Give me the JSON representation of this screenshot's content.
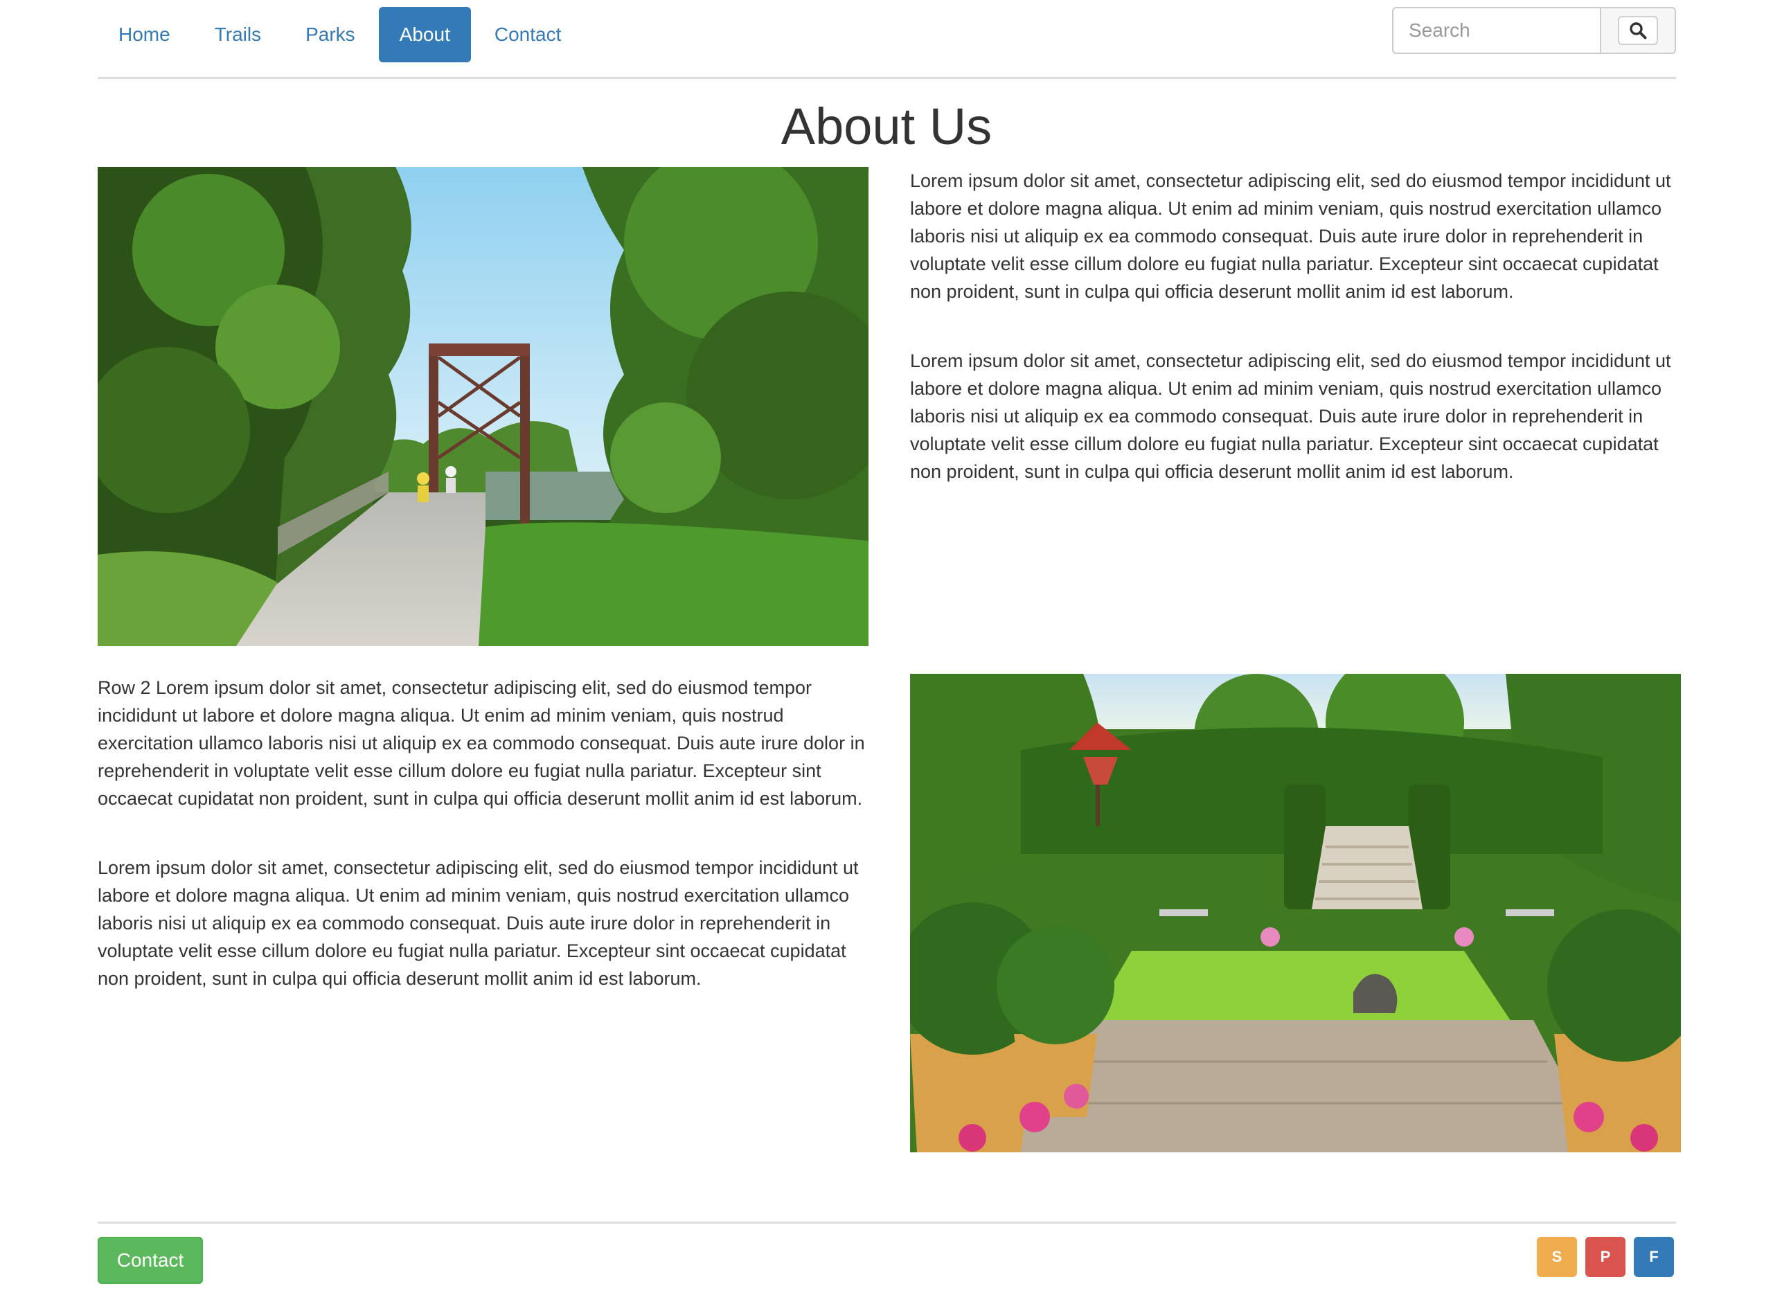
{
  "nav": {
    "tabs": [
      {
        "label": "Home"
      },
      {
        "label": "Trails"
      },
      {
        "label": "Parks"
      },
      {
        "label": "About"
      },
      {
        "label": "Contact"
      }
    ],
    "active_tab": "About",
    "search": {
      "placeholder": "Search",
      "value": "",
      "button_icon": "search-icon"
    }
  },
  "page": {
    "title": "About Us"
  },
  "row1": {
    "image": {
      "subject": "trail-bridge-photo"
    },
    "paragraphs": [
      "Lorem ipsum dolor sit amet, consectetur adipiscing elit, sed do eiusmod tempor incididunt ut labore et dolore magna aliqua. Ut enim ad minim veniam, quis nostrud exercitation ullamco laboris nisi ut aliquip ex ea commodo consequat. Duis aute irure dolor in reprehenderit in voluptate velit esse cillum dolore eu fugiat nulla pariatur. Excepteur sint occaecat cupidatat non proident, sunt in culpa qui officia deserunt mollit anim id est laborum.",
      "Lorem ipsum dolor sit amet, consectetur adipiscing elit, sed do eiusmod tempor incididunt ut labore et dolore magna aliqua. Ut enim ad minim veniam, quis nostrud exercitation ullamco laboris nisi ut aliquip ex ea commodo consequat. Duis aute irure dolor in reprehenderit in voluptate velit esse cillum dolore eu fugiat nulla pariatur. Excepteur sint occaecat cupidatat non proident, sunt in culpa qui officia deserunt mollit anim id est laborum."
    ]
  },
  "row2": {
    "image": {
      "subject": "formal-garden-photo"
    },
    "paragraphs": [
      "Row 2 Lorem ipsum dolor sit amet, consectetur adipiscing elit, sed do eiusmod tempor incididunt ut labore et dolore magna aliqua. Ut enim ad minim veniam, quis nostrud exercitation ullamco laboris nisi ut aliquip ex ea commodo consequat. Duis aute irure dolor in reprehenderit in voluptate velit esse cillum dolore eu fugiat nulla pariatur. Excepteur sint occaecat cupidatat non proident, sunt in culpa qui officia deserunt mollit anim id est laborum.",
      "Lorem ipsum dolor sit amet, consectetur adipiscing elit, sed do eiusmod tempor incididunt ut labore et dolore magna aliqua. Ut enim ad minim veniam, quis nostrud exercitation ullamco laboris nisi ut aliquip ex ea commodo consequat. Duis aute irure dolor in reprehenderit in voluptate velit esse cillum dolore eu fugiat nulla pariatur. Excepteur sint occaecat cupidatat non proident, sunt in culpa qui officia deserunt mollit anim id est laborum."
    ]
  },
  "footer": {
    "contact_label": "Contact",
    "social": [
      {
        "label": "S",
        "color": "#f0ad4e"
      },
      {
        "label": "P",
        "color": "#d9534f"
      },
      {
        "label": "F",
        "color": "#337ab7"
      }
    ]
  },
  "colors": {
    "link": "#337ab7",
    "success": "#5cb85c",
    "warning": "#f0ad4e",
    "danger": "#d9534f"
  }
}
